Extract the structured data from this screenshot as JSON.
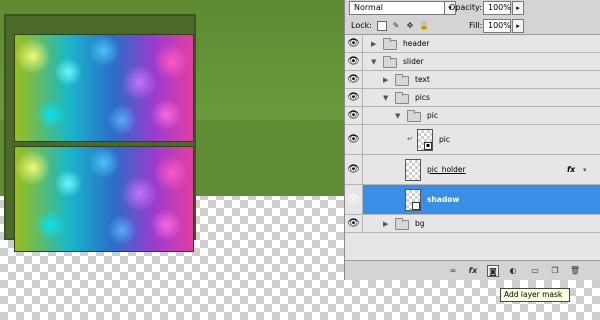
{
  "panel": {
    "blend_mode": "Normal",
    "opacity_label": "Opacity:",
    "opacity_value": "100%",
    "lock_label": "Lock:",
    "fill_label": "Fill:",
    "fill_value": "100%"
  },
  "layers": [
    {
      "name": "header",
      "type": "group"
    },
    {
      "name": "slider",
      "type": "group"
    },
    {
      "name": "text",
      "type": "group"
    },
    {
      "name": "pics",
      "type": "group"
    },
    {
      "name": "pic",
      "type": "group"
    },
    {
      "name": "pic",
      "type": "smart-object"
    },
    {
      "name": "pic_holder",
      "type": "layer",
      "fx": "fx"
    },
    {
      "name": "shadow",
      "type": "layer",
      "selected": true
    },
    {
      "name": "bg",
      "type": "group"
    }
  ],
  "tooltip": "Add layer mask",
  "colors": {
    "canvas_green": "#5f8c35",
    "selection_blue": "#3a8ee6"
  }
}
